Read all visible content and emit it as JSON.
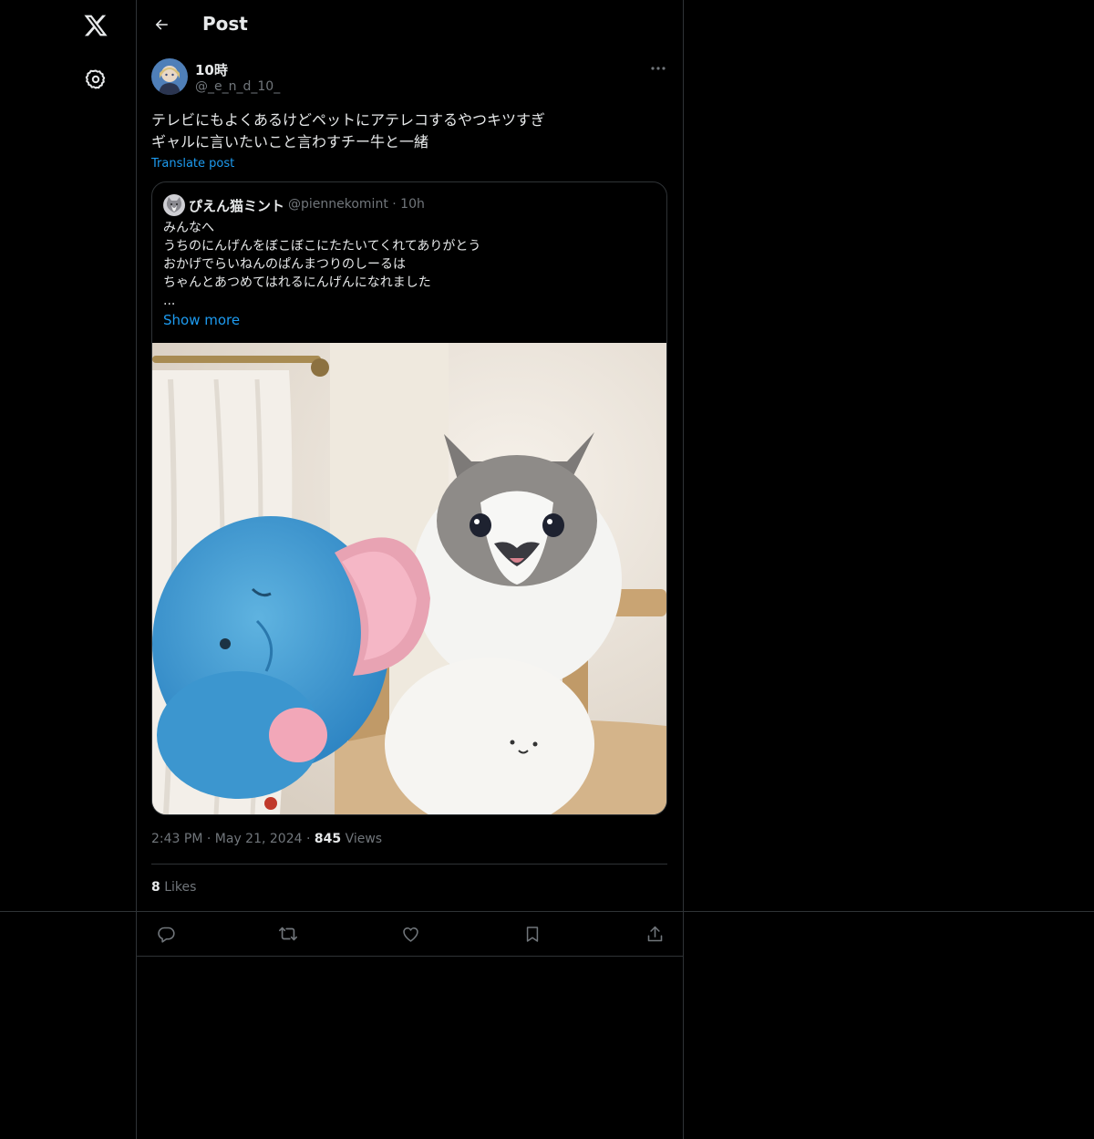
{
  "header": {
    "title": "Post"
  },
  "post": {
    "author_name": "10時",
    "author_handle": "@_e_n_d_10_",
    "text_lines": [
      "テレビにもよくあるけどペットにアテレコするやつキツすぎ",
      "ギャルに言いたいこと言わすチー牛と一緒"
    ],
    "translate_label": "Translate post",
    "time": "2:43 PM",
    "date": "May 21, 2024",
    "views_count": "845",
    "views_label": "Views",
    "likes_count": "8",
    "likes_label": "Likes"
  },
  "quote": {
    "name": "ぴえん猫ミント",
    "handle": "@piennekomint",
    "time": "10h",
    "text_lines": [
      "みんなへ",
      "うちのにんげんをぼこぼこにたたいてくれてありがとう",
      "おかげでらいねんのぱんまつりのしーるは",
      "ちゃんとあつめてはれるにんげんになれました",
      "..."
    ],
    "show_more_label": "Show more"
  },
  "icons": {
    "nav": [
      "x-logo-icon",
      "settings-gear-icon"
    ],
    "actions": [
      "reply-icon",
      "repost-icon",
      "like-icon",
      "bookmark-icon",
      "share-icon"
    ]
  },
  "colors": {
    "background": "#000000",
    "text": "#e7e9ea",
    "muted": "#71767b",
    "accent": "#1d9bf0",
    "border": "#2f3336"
  }
}
